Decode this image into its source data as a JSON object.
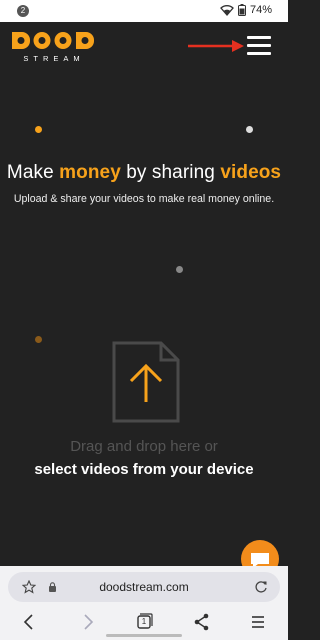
{
  "status": {
    "notification_count": "2",
    "battery": "74%"
  },
  "colors": {
    "accent": "#f7a21b",
    "background": "#222222",
    "annotation_arrow": "#e53020"
  },
  "logo": {
    "word": "DOOD",
    "sub": "STREAM"
  },
  "hero": {
    "title_part1": "Make ",
    "title_accent1": "money",
    "title_part2": " by sharing ",
    "title_accent2": "videos",
    "subtitle": "Upload & share your videos to make real money online."
  },
  "upload": {
    "drag_text": "Drag and drop here or",
    "select_text": "select videos from your device"
  },
  "browser": {
    "url": "doodstream.com",
    "tab_count": "1"
  }
}
